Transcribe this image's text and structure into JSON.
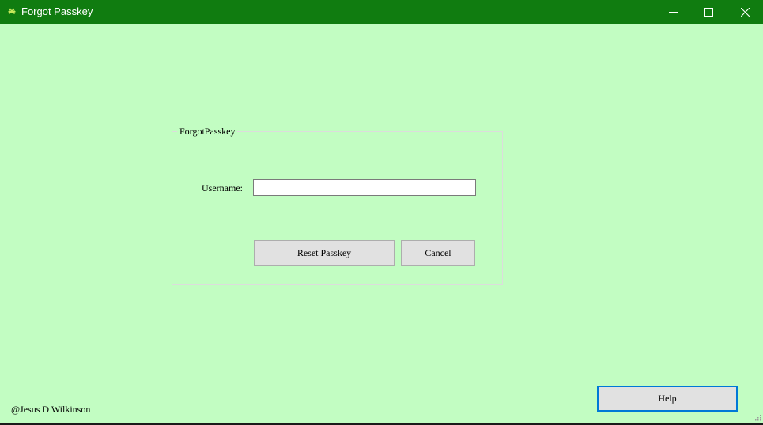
{
  "window": {
    "title": "Forgot Passkey",
    "app_icon": "frog-icon",
    "controls": [
      "minimize-icon",
      "maximize-icon",
      "close-icon"
    ],
    "colors": {
      "titlebar": "#107c10",
      "background": "#c2fdc2",
      "focus_border": "#0078d7"
    }
  },
  "form": {
    "group_title": "ForgotPasskey",
    "username_label": "Username:",
    "username_value": "",
    "reset_button_label": "Reset Passkey",
    "cancel_button_label": "Cancel"
  },
  "footer": {
    "copyright": "@Jesus D Wilkinson",
    "help_button_label": "Help"
  }
}
